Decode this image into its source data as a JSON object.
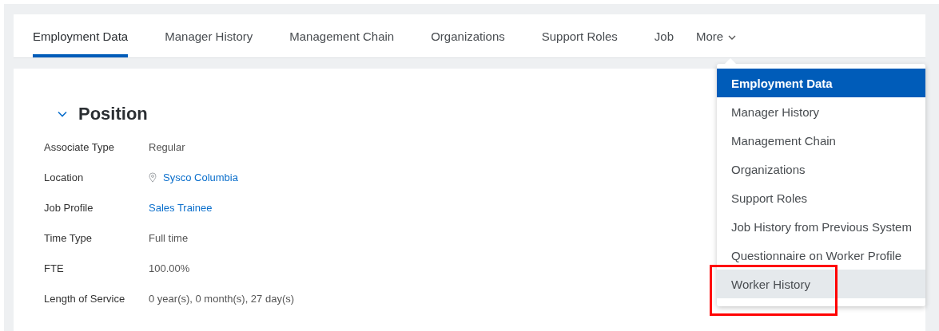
{
  "tabs": [
    {
      "label": "Employment Data",
      "selected": true
    },
    {
      "label": "Manager History",
      "selected": false
    },
    {
      "label": "Management Chain",
      "selected": false
    },
    {
      "label": "Organizations",
      "selected": false
    },
    {
      "label": "Support Roles",
      "selected": false
    },
    {
      "label": "Job",
      "selected": false
    }
  ],
  "more_button": {
    "label": "More",
    "expanded": true
  },
  "more_menu": [
    {
      "label": "Employment Data",
      "selected": true,
      "hovered": false,
      "annotated": false
    },
    {
      "label": "Manager History",
      "selected": false,
      "hovered": false,
      "annotated": false
    },
    {
      "label": "Management Chain",
      "selected": false,
      "hovered": false,
      "annotated": false
    },
    {
      "label": "Organizations",
      "selected": false,
      "hovered": false,
      "annotated": false
    },
    {
      "label": "Support Roles",
      "selected": false,
      "hovered": false,
      "annotated": false
    },
    {
      "label": "Job History from Previous System",
      "selected": false,
      "hovered": false,
      "annotated": false
    },
    {
      "label": "Questionnaire on Worker Profile",
      "selected": false,
      "hovered": false,
      "annotated": false
    },
    {
      "label": "Worker History",
      "selected": false,
      "hovered": true,
      "annotated": true
    }
  ],
  "section": {
    "title": "Position",
    "expanded": true,
    "fields": [
      {
        "label": "Associate Type",
        "value": "Regular",
        "kind": "text"
      },
      {
        "label": "Location",
        "value": "Sysco Columbia",
        "kind": "place"
      },
      {
        "label": "Job Profile",
        "value": "Sales Trainee",
        "kind": "link"
      },
      {
        "label": "Time Type",
        "value": "Full time",
        "kind": "text"
      },
      {
        "label": "FTE",
        "value": "100.00%",
        "kind": "text"
      },
      {
        "label": "Length of Service",
        "value": "0 year(s), 0 month(s), 27 day(s)",
        "kind": "text"
      }
    ]
  }
}
